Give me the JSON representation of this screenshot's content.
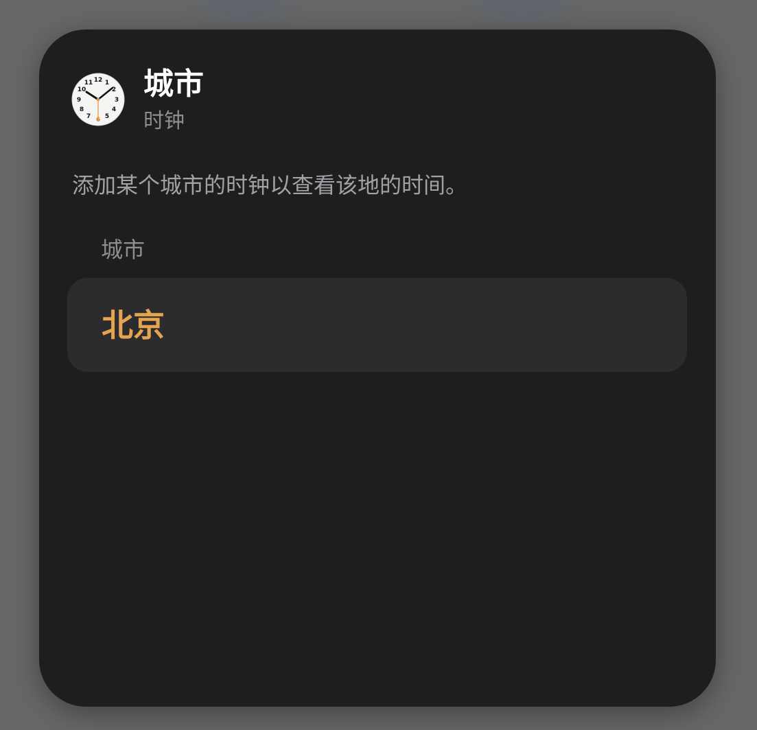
{
  "widget": {
    "title": "城市",
    "app_name": "时钟",
    "description": "添加某个城市的时钟以查看该地的时间。",
    "app_icon": "analog-clock-icon",
    "section_label": "城市",
    "city_value": "北京"
  },
  "clock_face": {
    "numbers": [
      "12",
      "1",
      "2",
      "3",
      "4",
      "5",
      "6",
      "7",
      "8",
      "9",
      "10",
      "11"
    ],
    "time_shown": "10:09:30"
  },
  "colors": {
    "background_dim": "#666766",
    "card": "#1e1e1e",
    "row": "#2c2c2e",
    "title": "#ffffff",
    "secondary_text": "#8e8e92",
    "accent": "#e5a450"
  }
}
